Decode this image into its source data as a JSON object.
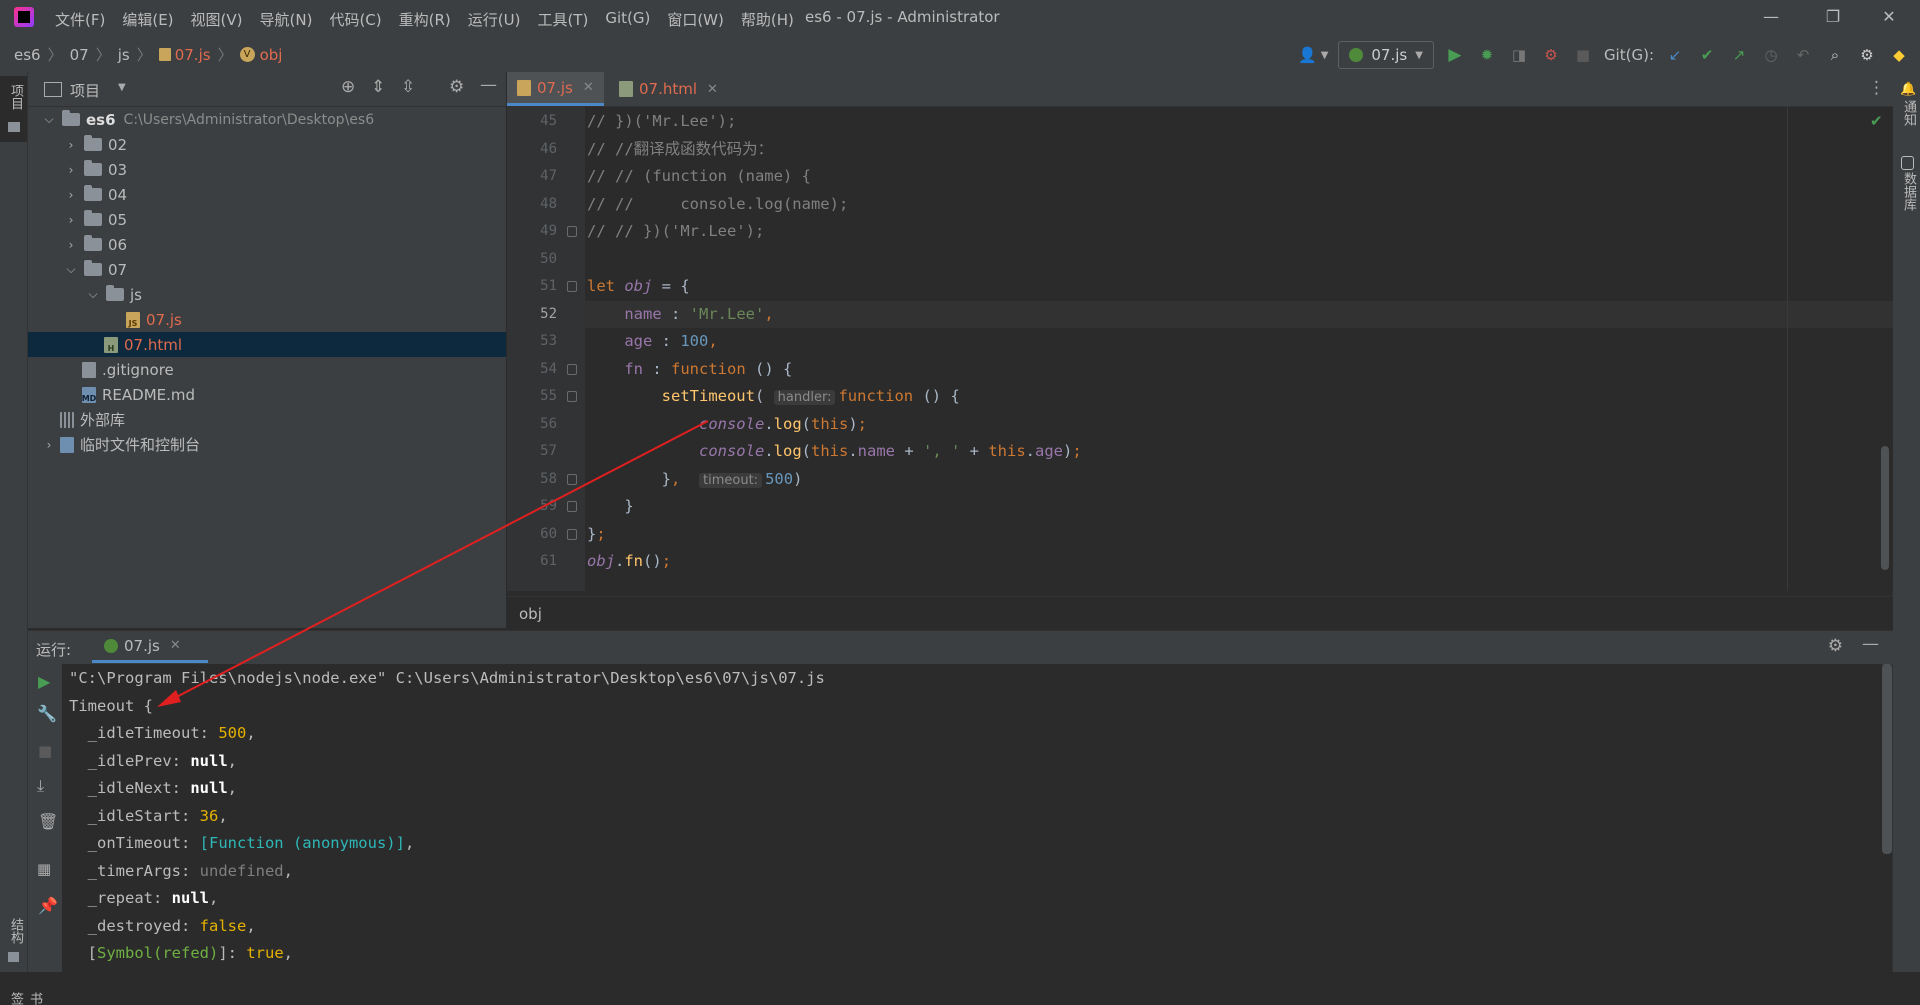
{
  "window": {
    "title": "es6 - 07.js - Administrator",
    "menu": [
      "文件(F)",
      "编辑(E)",
      "视图(V)",
      "导航(N)",
      "代码(C)",
      "重构(R)",
      "运行(U)",
      "工具(T)",
      "Git(G)",
      "窗口(W)",
      "帮助(H)"
    ],
    "controls": {
      "minimize": "—",
      "restore": "❐",
      "close": "✕"
    }
  },
  "breadcrumb": [
    "es6",
    "07",
    "js",
    "07.js",
    "obj"
  ],
  "toolbar": {
    "run_config": "07.js",
    "git_label": "Git(G):"
  },
  "left_stripe": {
    "project": "项目",
    "structure": "结构",
    "bookmarks": "书签"
  },
  "right_stripe": {
    "notifications": "通知",
    "database": "数据库"
  },
  "project_panel": {
    "title": "项目",
    "tree": [
      {
        "label": "es6",
        "path": "C:\\Users\\Administrator\\Desktop\\es6",
        "type": "folder",
        "expanded": true,
        "depth": 0
      },
      {
        "label": "02",
        "type": "folder",
        "depth": 1
      },
      {
        "label": "03",
        "type": "folder",
        "depth": 1
      },
      {
        "label": "04",
        "type": "folder",
        "depth": 1
      },
      {
        "label": "05",
        "type": "folder",
        "depth": 1
      },
      {
        "label": "06",
        "type": "folder",
        "depth": 1
      },
      {
        "label": "07",
        "type": "folder",
        "expanded": true,
        "depth": 1
      },
      {
        "label": "js",
        "type": "folder",
        "expanded": true,
        "depth": 2
      },
      {
        "label": "07.js",
        "type": "js",
        "depth": 3
      },
      {
        "label": "07.html",
        "type": "html",
        "depth": 2,
        "selected": true
      },
      {
        "label": ".gitignore",
        "type": "txt",
        "depth": 1
      },
      {
        "label": "README.md",
        "type": "md",
        "depth": 1
      },
      {
        "label": "外部库",
        "type": "lib",
        "depth": 0
      },
      {
        "label": "临时文件和控制台",
        "type": "scratch",
        "depth": 0
      }
    ]
  },
  "editor": {
    "tabs": [
      {
        "label": "07.js",
        "active": true
      },
      {
        "label": "07.html",
        "active": false
      }
    ],
    "current_line": 52,
    "lines": [
      {
        "n": 45,
        "html": "<span class='c'>// })('Mr.Lee');</span>"
      },
      {
        "n": 46,
        "html": "<span class='c'>// //翻译成函数代码为：</span>"
      },
      {
        "n": 47,
        "html": "<span class='c'>// // (function (name) {</span>"
      },
      {
        "n": 48,
        "html": "<span class='c'>// //     console.log(name);</span>"
      },
      {
        "n": 49,
        "html": "<span class='c'>// // })('Mr.Lee');</span>"
      },
      {
        "n": 50,
        "html": ""
      },
      {
        "n": 51,
        "html": "<span class='k'>let </span><span class='pi'>obj</span> = {"
      },
      {
        "n": 52,
        "html": "    <span class='p'>name</span> : <span class='s'>'Mr.Lee'</span><span class='k'>,</span>"
      },
      {
        "n": 53,
        "html": "    <span class='p'>age</span> : <span class='n'>100</span><span class='k'>,</span>"
      },
      {
        "n": 54,
        "html": "    <span class='p'>fn</span> : <span class='k'>function</span> () {"
      },
      {
        "n": 55,
        "html": "        <span class='f'>setTimeout</span>( <span class='hint'>handler:</span><span class='k'>function</span> () {"
      },
      {
        "n": 56,
        "html": "            <span class='pi'>console</span>.<span class='f'>log</span>(<span class='k'>this</span>)<span class='k'>;</span>"
      },
      {
        "n": 57,
        "html": "            <span class='pi'>console</span>.<span class='f'>log</span>(<span class='k'>this</span>.<span class='p'>name</span> + <span class='s'>', '</span> + <span class='k'>this</span>.<span class='p'>age</span>)<span class='k'>;</span>"
      },
      {
        "n": 58,
        "html": "        }<span class='k'>, </span> <span class='hint'>timeout:</span><span class='n'>500</span>)"
      },
      {
        "n": 59,
        "html": "    }"
      },
      {
        "n": 60,
        "html": "}<span class='k'>;</span>"
      },
      {
        "n": 61,
        "html": "<span class='pi'>obj</span>.<span class='f'>fn</span>()<span class='k'>;</span>"
      }
    ],
    "footer_crumb": "obj"
  },
  "run_panel": {
    "label": "运行:",
    "tab": "07.js",
    "output": [
      {
        "html": "\"C:\\Program Files\\nodejs\\node.exe\" C:\\Users\\Administrator\\Desktop\\es6\\07\\js\\07.js"
      },
      {
        "html": "Timeout {"
      },
      {
        "html": "  _idleTimeout: <span class='o-n'>500</span>,"
      },
      {
        "html": "  _idlePrev: <span class='o-b'>null</span>,"
      },
      {
        "html": "  _idleNext: <span class='o-b'>null</span>,"
      },
      {
        "html": "  _idleStart: <span class='o-n'>36</span>,"
      },
      {
        "html": "  _onTimeout: <span class='o-cy'>[Function (anonymous)]</span>,"
      },
      {
        "html": "  _timerArgs: <span class='o-g'>undefined</span>,"
      },
      {
        "html": "  _repeat: <span class='o-b'>null</span>,"
      },
      {
        "html": "  _destroyed: <span class='o-n'>false</span>,"
      },
      {
        "html": "  [<span class='o-gr'>Symbol(refed)</span>]: <span class='o-n'>true</span>,"
      }
    ]
  },
  "colors": {
    "accent": "#4a88c7",
    "run_green": "#499c54",
    "arrow_red": "#e02020"
  }
}
